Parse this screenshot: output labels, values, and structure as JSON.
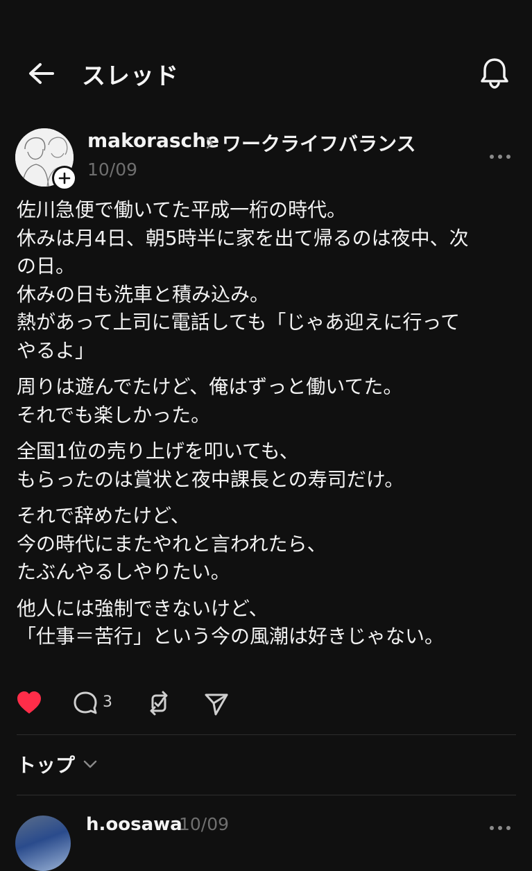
{
  "header": {
    "title": "スレッド",
    "back_icon": "arrow-left-icon",
    "bell_icon": "bell-icon"
  },
  "post": {
    "author": "makorasche",
    "topic": "ワークライフバランス",
    "date": "10/09",
    "paragraphs": [
      [
        "佐川急便で働いてた平成一桁の時代。",
        "休みは月4日、朝5時半に家を出て帰るのは夜中、次",
        "の日。",
        "休みの日も洗車と積み込み。",
        "熱があって上司に電話しても「じゃあ迎えに行って",
        "やるよ」"
      ],
      [
        "周りは遊んでたけど、俺はずっと働いてた。",
        "それでも楽しかった。"
      ],
      [
        "全国1位の売り上げを叩いても、",
        "もらったのは賞状と夜中課長との寿司だけ。"
      ],
      [
        "それで辞めたけど、",
        "今の時代にまたやれと言われたら、",
        "たぶんやるしやりたい。"
      ],
      [
        "他人には強制できないけど、",
        "「仕事＝苦行」という今の風潮は好きじゃない。"
      ]
    ],
    "reply_count": "3",
    "liked": true,
    "like_color": "#ff2d49"
  },
  "sort": {
    "label": "トップ"
  },
  "reply": {
    "author": "h.oosawa",
    "date": "10/09"
  },
  "colors": {
    "background": "#101010",
    "text": "#f3f3f3",
    "muted": "#6f6f6f",
    "divider": "#2e2e2e"
  }
}
